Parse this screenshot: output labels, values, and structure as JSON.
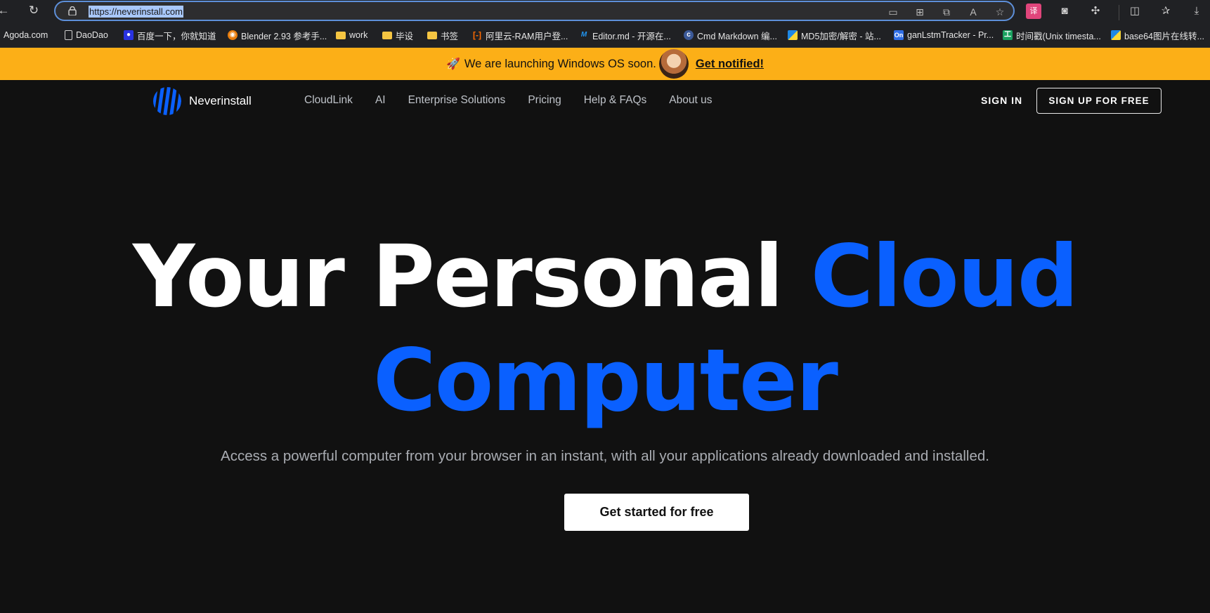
{
  "browser": {
    "url": "https://neverinstall.com",
    "nav_icons": [
      "back-icon",
      "reload-icon"
    ],
    "url_icons": [
      "cast-icon",
      "apps-icon",
      "split-icon",
      "read-aloud-icon",
      "star-icon"
    ],
    "ext_icons": [
      "translate-icon",
      "glasses-icon",
      "extensions-icon",
      "split-screen-icon",
      "favorites-icon",
      "download-icon"
    ]
  },
  "bookmarks": [
    {
      "label": "Agoda.com",
      "icon": "agoda-icon",
      "color": "#202124"
    },
    {
      "label": "DaoDao",
      "icon": "page-icon",
      "color": "#202124"
    },
    {
      "label": "百度一下，你就知道",
      "icon": "baidu-icon",
      "color": "#2932e1"
    },
    {
      "label": "Blender 2.93 参考手...",
      "icon": "blender-icon",
      "color": "#e87d0d"
    },
    {
      "label": "work",
      "icon": "folder-icon",
      "color": "#f5c542"
    },
    {
      "label": "毕设",
      "icon": "folder-icon",
      "color": "#f5c542"
    },
    {
      "label": "书签",
      "icon": "folder-icon",
      "color": "#f5c542"
    },
    {
      "label": "阿里云-RAM用户登...",
      "icon": "aliyun-icon",
      "color": "#ff6a00"
    },
    {
      "label": "Editor.md - 开源在...",
      "icon": "editormd-icon",
      "color": "#2196f3"
    },
    {
      "label": "Cmd Markdown 编...",
      "icon": "cmd-markdown-icon",
      "color": "#3b5998"
    },
    {
      "label": "MD5加密/解密 - 站...",
      "icon": "md5-icon",
      "color": "#1e88e5"
    },
    {
      "label": "ganLstmTracker - Pr...",
      "icon": "overleaf-icon",
      "color": "#2f6ee7"
    },
    {
      "label": "时间戳(Unix timesta...",
      "icon": "timestamp-icon",
      "color": "#1aa260"
    },
    {
      "label": "base64图片在线转...",
      "icon": "base64-icon",
      "color": "#1e88e5"
    }
  ],
  "announcement": {
    "text": "We are launching Windows OS soon.",
    "cta": "Get notified!"
  },
  "header": {
    "brand": "Neverinstall",
    "nav": [
      "CloudLink",
      "AI",
      "Enterprise Solutions",
      "Pricing",
      "Help & FAQs",
      "About us"
    ],
    "signin": "SIGN IN",
    "signup": "SIGN UP FOR FREE"
  },
  "hero": {
    "title_white": "Your Personal",
    "title_blue_1": "Cloud",
    "title_blue_2": "Computer",
    "subtitle": "Access a powerful computer from your browser in an instant, with all your applications already downloaded and installed.",
    "button": "Get started for free"
  },
  "colors": {
    "accent": "#0a60ff",
    "announce_bg": "#fcaf17",
    "page_bg": "#111111"
  }
}
